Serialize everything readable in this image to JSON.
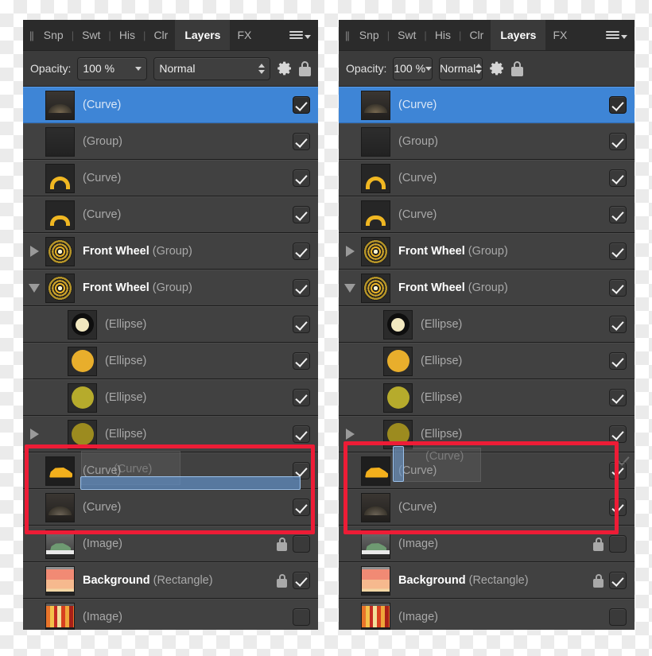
{
  "app": {
    "panel_title": "Layers",
    "accent_selected": "#3e85d6",
    "accent_annotation": "#ed1c36",
    "panel_bg": "#333333",
    "row_bg": "#414141"
  },
  "tabs": {
    "grip": "||",
    "items": [
      {
        "label": "Snp",
        "active": false
      },
      {
        "label": "Swt",
        "active": false
      },
      {
        "label": "His",
        "active": false
      },
      {
        "label": "Clr",
        "active": false
      },
      {
        "label": "Layers",
        "active": true
      },
      {
        "label": "FX",
        "active": false
      }
    ],
    "separator": "|",
    "menu_icon": "hamburger-menu-icon"
  },
  "toolbar": {
    "opacity_label": "Opacity:",
    "opacity_value": "100 %",
    "blend_mode": "Normal",
    "blend_options": [
      "Normal"
    ],
    "gear_icon": "gear-icon",
    "lock_icon": "lock-icon"
  },
  "layers": [
    {
      "name": "",
      "type": "(Curve)",
      "thumb": "curve-dark",
      "selected": true,
      "visible": true,
      "locked": false,
      "disclosure": "none",
      "indent": 0
    },
    {
      "name": "",
      "type": "(Group)",
      "thumb": "group-dark",
      "selected": false,
      "visible": true,
      "locked": false,
      "disclosure": "none",
      "indent": 0
    },
    {
      "name": "",
      "type": "(Curve)",
      "thumb": "curve-arc",
      "selected": false,
      "visible": true,
      "locked": false,
      "disclosure": "none",
      "indent": 0
    },
    {
      "name": "",
      "type": "(Curve)",
      "thumb": "curve-arc2",
      "selected": false,
      "visible": true,
      "locked": false,
      "disclosure": "none",
      "indent": 0
    },
    {
      "name": "Front Wheel",
      "type": "(Group)",
      "thumb": "wheel",
      "selected": false,
      "visible": true,
      "locked": false,
      "disclosure": "collapsed",
      "indent": 0
    },
    {
      "name": "Front Wheel",
      "type": "(Group)",
      "thumb": "wheel",
      "selected": false,
      "visible": true,
      "locked": false,
      "disclosure": "expanded",
      "indent": 0
    },
    {
      "name": "",
      "type": "(Ellipse)",
      "thumb": "ellipse-ring",
      "selected": false,
      "visible": true,
      "locked": false,
      "disclosure": "none",
      "indent": 1
    },
    {
      "name": "",
      "type": "(Ellipse)",
      "thumb": "ellipse-orange",
      "selected": false,
      "visible": true,
      "locked": false,
      "disclosure": "none",
      "indent": 1
    },
    {
      "name": "",
      "type": "(Ellipse)",
      "thumb": "ellipse-olive",
      "selected": false,
      "visible": true,
      "locked": false,
      "disclosure": "none",
      "indent": 1
    },
    {
      "name": "",
      "type": "(Ellipse)",
      "thumb": "ellipse-dark",
      "selected": false,
      "visible": true,
      "locked": false,
      "disclosure": "collapsed",
      "indent": 1
    },
    {
      "name": "",
      "type": "(Curve)",
      "thumb": "car-yellow",
      "selected": false,
      "visible": true,
      "locked": false,
      "disclosure": "none",
      "indent": 0
    },
    {
      "name": "",
      "type": "(Curve)",
      "thumb": "humps",
      "selected": false,
      "visible": true,
      "locked": false,
      "disclosure": "none",
      "indent": 0
    },
    {
      "name": "",
      "type": "(Image)",
      "thumb": "photo-car",
      "selected": false,
      "visible": false,
      "locked": true,
      "disclosure": "none",
      "indent": 0
    },
    {
      "name": "Background",
      "type": "(Rectangle)",
      "thumb": "grad-sunset",
      "selected": false,
      "visible": true,
      "locked": true,
      "disclosure": "none",
      "indent": 0
    },
    {
      "name": "",
      "type": "(Image)",
      "thumb": "stripes",
      "selected": false,
      "visible": false,
      "locked": false,
      "disclosure": "none",
      "indent": 0
    }
  ],
  "drag_state": {
    "left_panel": {
      "ghost_label": "(Curve)",
      "indicator": "horizontal-drop-bar",
      "description": "dragging layer between the two (Curve) rows"
    },
    "right_panel": {
      "ghost_label": "(Curve)",
      "indicator": "vertical-drop-bar",
      "description": "dragging layer onto the first (Curve) row"
    }
  },
  "annotations": {
    "left_box_label": "",
    "right_box_label": "",
    "color": "#ed1c36"
  }
}
